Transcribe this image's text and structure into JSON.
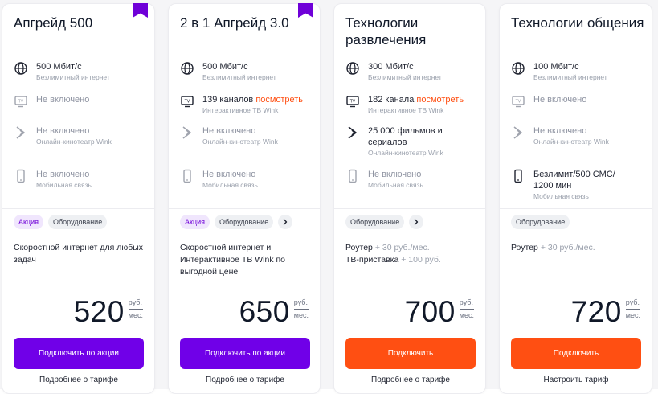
{
  "tariffs": [
    {
      "title": "Апгрейд 500",
      "features": {
        "internet": {
          "main": "500 Мбит/с",
          "sub": "Безлимитный интернет"
        },
        "tv": {
          "main": "Не включено"
        },
        "cinema": {
          "main": "Не включено",
          "sub": "Онлайн-кинотеатр Wink"
        },
        "mobile": {
          "main": "Не включено",
          "sub": "Мобильная связь"
        }
      },
      "chips": {
        "promo": "Акция",
        "equipment": "Оборудование"
      },
      "description": "Скоростной интернет для любых задач",
      "price": {
        "value": "520",
        "currency": "руб.",
        "period": "мес."
      },
      "button": "Подключить по акции",
      "link": "Подробнее о тарифе"
    },
    {
      "title": "2 в 1 Апгрейд 3.0",
      "features": {
        "internet": {
          "main": "500 Мбит/с",
          "sub": "Безлимитный интернет"
        },
        "tv": {
          "main": "139 каналов",
          "link": "посмотреть",
          "sub": "Интерактивное ТВ Wink"
        },
        "cinema": {
          "main": "Не включено",
          "sub": "Онлайн-кинотеатр Wink"
        },
        "mobile": {
          "main": "Не включено",
          "sub": "Мобильная связь"
        }
      },
      "chips": {
        "promo": "Акция",
        "equipment": "Оборудование"
      },
      "description": "Скоростной интернет и Интерактивное ТВ Wink по выгодной цене",
      "price": {
        "value": "650",
        "currency": "руб.",
        "period": "мес."
      },
      "button": "Подключить по акции",
      "link": "Подробнее о тарифе"
    },
    {
      "title": "Технологии развлечения",
      "features": {
        "internet": {
          "main": "300 Мбит/с",
          "sub": "Безлимитный интернет"
        },
        "tv": {
          "main": "182 канала",
          "link": "посмотреть",
          "sub": "Интерактивное ТВ Wink"
        },
        "cinema": {
          "main": "25 000 фильмов и сериалов",
          "sub": "Онлайн-кинотеатр Wink"
        },
        "mobile": {
          "main": "Не включено",
          "sub": "Мобильная связь"
        }
      },
      "chips": {
        "equipment": "Оборудование"
      },
      "description": {
        "line1": "Роутер",
        "line1_extra": "+ 30 руб./мес.",
        "line2": "ТВ-приставка",
        "line2_extra": "+ 100 руб."
      },
      "price": {
        "value": "700",
        "currency": "руб.",
        "period": "мес."
      },
      "button": "Подключить",
      "link": "Подробнее о тарифе"
    },
    {
      "title": "Технологии общения",
      "features": {
        "internet": {
          "main": "100 Мбит/с",
          "sub": "Безлимитный интернет"
        },
        "tv": {
          "main": "Не включено"
        },
        "cinema": {
          "main": "Не включено",
          "sub": "Онлайн-кинотеатр Wink"
        },
        "mobile": {
          "main": "Безлимит/500 СМС/ 1200 мин",
          "sub": "Мобильная связь"
        }
      },
      "chips": {
        "equipment": "Оборудование"
      },
      "description": {
        "line1": "Роутер",
        "line1_extra": "+ 30 руб./мес."
      },
      "price": {
        "value": "720",
        "currency": "руб.",
        "period": "мес."
      },
      "button": "Подключить",
      "link": "Настроить тариф"
    }
  ],
  "colors": {
    "accent_purple": "#7000e8",
    "accent_orange": "#ff4f12",
    "link": "#ff4f12"
  },
  "icons": {
    "internet": "globe-icon",
    "tv": "tv-icon",
    "cinema": "wink-icon",
    "mobile": "phone-icon",
    "more": "chevron-right-icon"
  }
}
